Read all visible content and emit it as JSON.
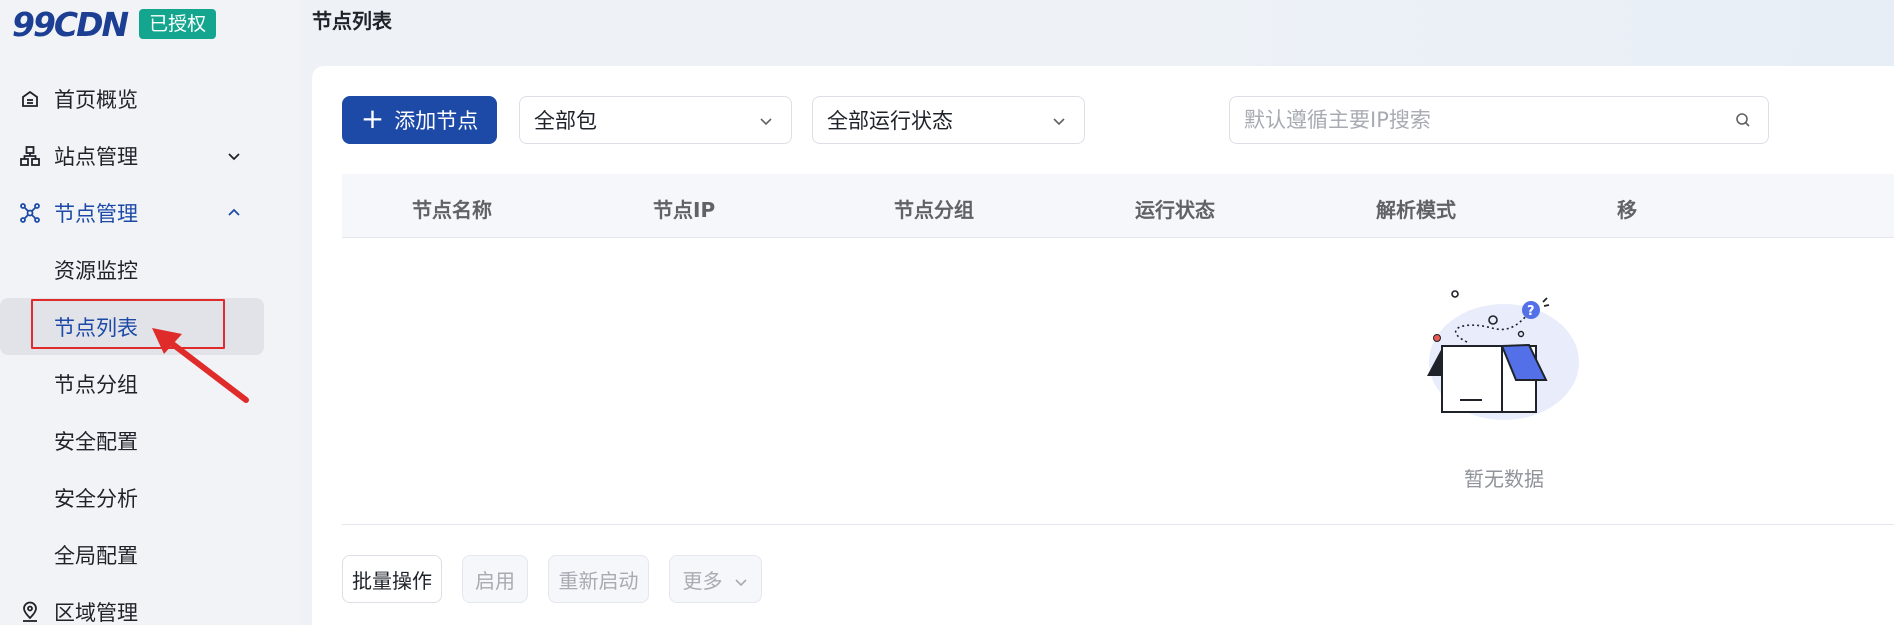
{
  "brand": {
    "logo_text": "99CDN",
    "badge": "已授权"
  },
  "page": {
    "title": "节点列表"
  },
  "sidebar": {
    "items": [
      {
        "label": "首页概览",
        "icon": "home-icon"
      },
      {
        "label": "站点管理",
        "icon": "site-tree-icon",
        "expandable": true,
        "expanded": false
      },
      {
        "label": "节点管理",
        "icon": "node-network-icon",
        "expandable": true,
        "expanded": true
      },
      {
        "label": "资源监控"
      },
      {
        "label": "节点列表",
        "selected": true
      },
      {
        "label": "节点分组"
      },
      {
        "label": "安全配置"
      },
      {
        "label": "安全分析"
      },
      {
        "label": "全局配置"
      },
      {
        "label": "区域管理",
        "icon": "location-icon"
      }
    ]
  },
  "toolbar": {
    "add_button": "添加节点",
    "package_select": "全部包",
    "status_select": "全部运行状态",
    "search_placeholder": "默认遵循主要IP搜索"
  },
  "table": {
    "columns": [
      "节点名称",
      "节点IP",
      "节点分组",
      "运行状态",
      "解析模式",
      "移"
    ],
    "rows": [],
    "empty_text": "暂无数据"
  },
  "footer": {
    "batch": "批量操作",
    "enable": "启用",
    "restart": "重新启动",
    "more": "更多"
  },
  "colors": {
    "primary": "#1c4aa6",
    "badge": "#13a58e",
    "annotation": "#e02b2b"
  }
}
